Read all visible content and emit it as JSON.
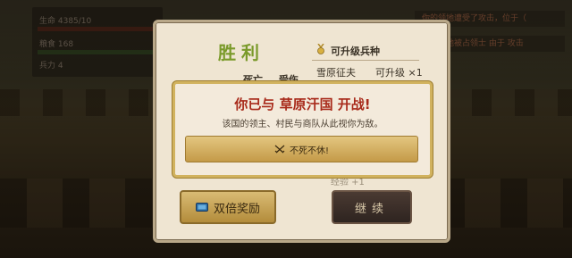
{
  "background": {
    "status_panel": {
      "row1": "生命 4385/10",
      "row2": "粮食 168",
      "row3": "兵力 4"
    },
    "notices": [
      "你的领地遭受了攻击，位于（",
      "你的领地被占领士 由于 攻击"
    ]
  },
  "victory": {
    "title": "胜利",
    "left_col_labels": [
      "死亡",
      "受伤"
    ],
    "upgradable_header": "可升级兵种",
    "unit_name": "雪原征夫",
    "unit_status": "可升级 ×1",
    "faint_text": "经验 +1",
    "double_reward_label": "双倍奖励",
    "continue_label": "继续"
  },
  "war_dialog": {
    "title": "你已与 草原汗国 开战!",
    "description": "该国的领主、村民与商队从此视你为敌。",
    "button_label": "不死不休!",
    "button_icon": "crossed-swords-icon"
  },
  "colors": {
    "war_title": "#a82a1a",
    "victory_title": "#7a9a2a",
    "gold_button": "#d9bb74",
    "dark_button": "#3a2e28"
  }
}
